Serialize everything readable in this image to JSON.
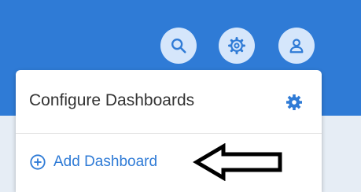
{
  "header": {
    "icons": [
      "search-icon",
      "gear-icon",
      "user-icon"
    ],
    "bar_color": "#2f7bd6",
    "icon_bg": "#d5e6fb"
  },
  "dashboard_menu": {
    "title": "Configure Dashboards",
    "settings_icon": "gear-icon",
    "add_label": "Add Dashboard",
    "add_icon": "plus-circle-icon",
    "accent": "#2f7bd6"
  },
  "annotation": {
    "icon": "arrow-left-icon"
  }
}
